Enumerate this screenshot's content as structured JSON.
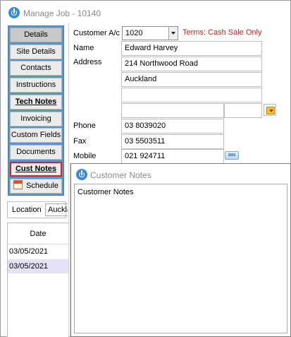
{
  "window": {
    "title": "Manage Job - 10140"
  },
  "nav": {
    "items": [
      {
        "label": "Details",
        "state": "active"
      },
      {
        "label": "Site Details"
      },
      {
        "label": "Contacts"
      },
      {
        "label": "Instructions"
      },
      {
        "label": "Tech Notes",
        "style": "bold-underline"
      },
      {
        "label": "Invoicing"
      },
      {
        "label": "Custom Fields"
      },
      {
        "label": "Documents"
      },
      {
        "label": "Cust Notes",
        "style": "bold-underline",
        "state": "selected"
      },
      {
        "label": "Schedule",
        "icon": "calendar-icon"
      }
    ]
  },
  "location": {
    "label": "Location",
    "value": "Auckla"
  },
  "dates": {
    "header": "Date",
    "rows": [
      "03/05/2021",
      "03/05/2021"
    ]
  },
  "form": {
    "customer_ac_label": "Customer A/c",
    "customer_ac_value": "1020",
    "terms": "Terms: Cash Sale Only",
    "name_label": "Name",
    "name_value": "Edward Harvey",
    "address_label": "Address",
    "address_line1": "214 Northwood Road",
    "address_line2": "Auckland",
    "address_line3": "",
    "address_line4": "",
    "address_line5": "",
    "phone_label": "Phone",
    "phone_value": "03 8039020",
    "fax_label": "Fax",
    "fax_value": "03 5503511",
    "mobile_label": "Mobile",
    "mobile_value": "021 924711",
    "sms_label": "SMS"
  },
  "notes_dialog": {
    "title": "Customer Notes",
    "content": "Customer Notes"
  },
  "colors": {
    "nav_frame": "#5b95c5",
    "selected_border": "#d22727",
    "terms_text": "#d21d1d",
    "highlight_row": "#e5e2f7"
  }
}
